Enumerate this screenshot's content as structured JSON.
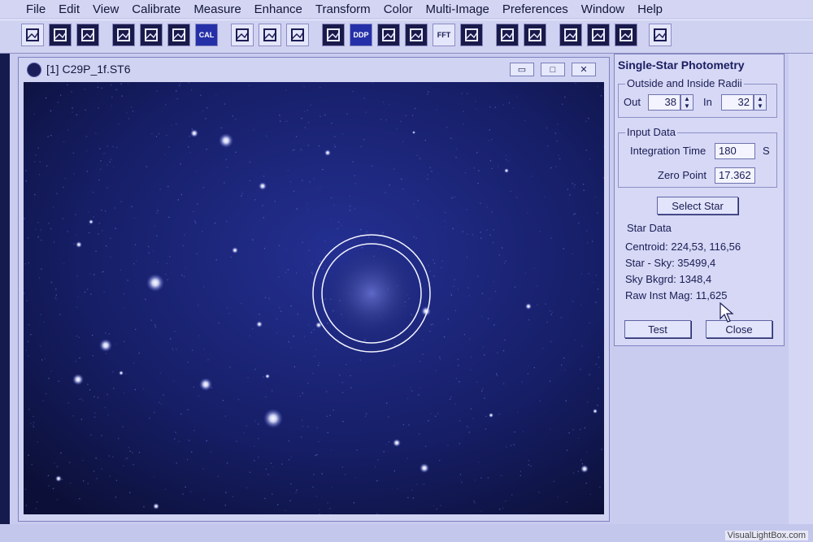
{
  "menubar": {
    "items": [
      "File",
      "Edit",
      "View",
      "Calibrate",
      "Measure",
      "Enhance",
      "Transform",
      "Color",
      "Multi-Image",
      "Preferences",
      "Window",
      "Help"
    ]
  },
  "toolbar": {
    "buttons": [
      {
        "name": "open-folder-icon"
      },
      {
        "name": "save-icon"
      },
      {
        "name": "save-all-icon"
      },
      {
        "name": "frame-icon"
      },
      {
        "name": "crop-icon"
      },
      {
        "name": "copy-icon"
      },
      {
        "name": "cal-icon",
        "label": "CAL"
      },
      {
        "name": "histogram-icon"
      },
      {
        "name": "curve-icon"
      },
      {
        "name": "levels-icon"
      },
      {
        "name": "stack-icon"
      },
      {
        "name": "ddp-icon",
        "label": "DDP"
      },
      {
        "name": "star-icon"
      },
      {
        "name": "wand-icon"
      },
      {
        "name": "fft-icon",
        "label": "FFT"
      },
      {
        "name": "grid-icon"
      },
      {
        "name": "image-icon"
      },
      {
        "name": "galaxy-icon"
      },
      {
        "name": "color-grid-icon"
      },
      {
        "name": "align-icon"
      },
      {
        "name": "tile-icon"
      },
      {
        "name": "help-book-icon"
      }
    ]
  },
  "image_window": {
    "title": "[1] C29P_1f.ST6",
    "controls": {
      "minimize": "▭",
      "maximize": "□",
      "close": "✕"
    }
  },
  "photometry": {
    "title": "Single-Star Photometry",
    "radii": {
      "label": "Outside and Inside Radii",
      "out_label": "Out",
      "out_value": "38",
      "in_label": "In",
      "in_value": "32"
    },
    "input": {
      "label": "Input Data",
      "integration_label": "Integration Time",
      "integration_value": "180",
      "integration_unit": "S",
      "zero_label": "Zero Point",
      "zero_value": "17.362"
    },
    "select_star": "Select Star",
    "star_data": {
      "label": "Star Data",
      "centroid": "Centroid: 224,53, 116,56",
      "star_sky": "Star - Sky: 35499,4",
      "sky": "Sky Bkgrd: 1348,4",
      "mag": "Raw Inst Mag: 11,625"
    },
    "test_button": "Test",
    "close_button": "Close"
  },
  "watermark": "VisualLightBox.com",
  "colors": {
    "sky": "#0f1446",
    "accent": "#1a1d60",
    "panel": "#d6d8f5"
  }
}
